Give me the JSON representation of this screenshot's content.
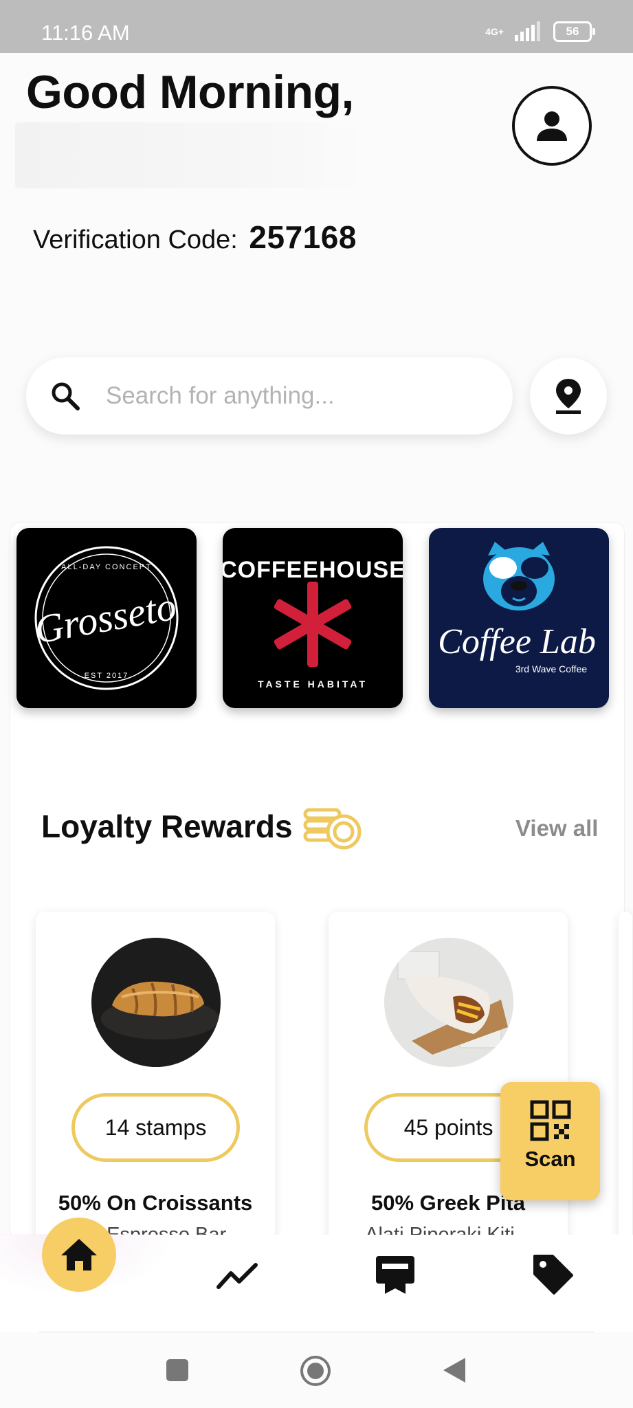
{
  "status_bar": {
    "time": "11:16 AM",
    "network": "4G+",
    "battery": "56"
  },
  "header": {
    "greeting": "Good Morning,",
    "verification_label": "Verification Code:",
    "verification_code": "257168"
  },
  "search": {
    "placeholder": "Search for anything..."
  },
  "brands": [
    {
      "name": "Grosseto",
      "tagline": "ALL-DAY CONCEPT",
      "est": "EST 2017"
    },
    {
      "name": "COFFEEHOUSE",
      "tagline": "TASTE HABITAT"
    },
    {
      "name": "Coffee Lab",
      "tagline": "3rd Wave Coffee"
    }
  ],
  "loyalty": {
    "title": "Loyalty Rewards",
    "view_all": "View all",
    "cards": [
      {
        "badge": "14 stamps",
        "title": "50% On Croissants",
        "subtitle": "... Espresso Bar"
      },
      {
        "badge": "45 points",
        "title": "50% Greek Pita",
        "subtitle": "Alati Piperaki Kiti..."
      }
    ]
  },
  "scan_button": {
    "label": "Scan"
  },
  "colors": {
    "accent": "#f7cd66",
    "pill_border": "#edc960",
    "coffee_lab_bg": "#0c1a45"
  }
}
